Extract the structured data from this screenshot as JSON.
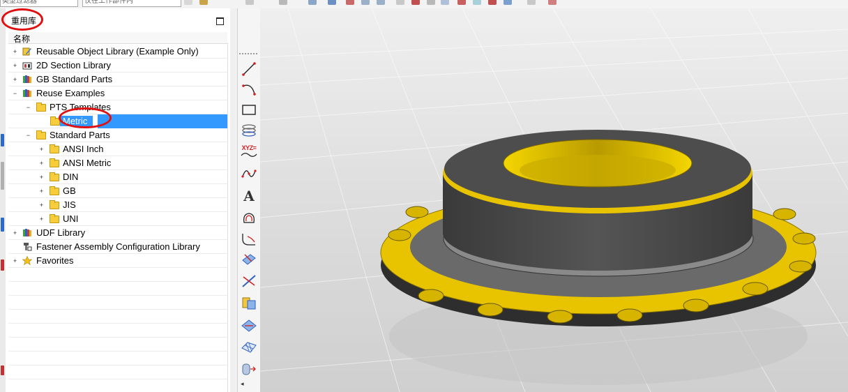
{
  "toolbar": {
    "combo_filter": "类型过滤器",
    "combo_scope": "仅在工作部件内"
  },
  "panel": {
    "title": "重用库",
    "column_header": "名称"
  },
  "tree": [
    {
      "label": "Reusable Object Library (Example Only)",
      "icon": "pencil-library-icon"
    },
    {
      "label": "2D Section Library",
      "icon": "section-library-icon"
    },
    {
      "label": "GB Standard Parts",
      "icon": "books-library-icon"
    },
    {
      "label": "Reuse Examples",
      "icon": "books-library-icon"
    },
    {
      "label": "PTS Templates",
      "icon": "folder-icon"
    },
    {
      "label": "Metric",
      "icon": "folder-icon"
    },
    {
      "label": "Standard Parts",
      "icon": "folder-icon"
    },
    {
      "label": "ANSI Inch",
      "icon": "folder-icon"
    },
    {
      "label": "ANSI Metric",
      "icon": "folder-icon"
    },
    {
      "label": "DIN",
      "icon": "folder-icon"
    },
    {
      "label": "GB",
      "icon": "folder-icon"
    },
    {
      "label": "JIS",
      "icon": "folder-icon"
    },
    {
      "label": "UNI",
      "icon": "folder-icon"
    },
    {
      "label": "UDF Library",
      "icon": "books-library-icon"
    },
    {
      "label": "Fastener Assembly Configuration Library",
      "icon": "fastener-library-icon"
    },
    {
      "label": "Favorites",
      "icon": "star-icon"
    }
  ],
  "selected_item": "Metric",
  "tools": {
    "text_tool_glyph": "A",
    "point_set_label": "XYZ="
  },
  "colors": {
    "selection": "#3399ff",
    "annotation_red": "#e01010",
    "gear_yellow": "#e8c400",
    "gear_gray": "#4a4a4a"
  }
}
